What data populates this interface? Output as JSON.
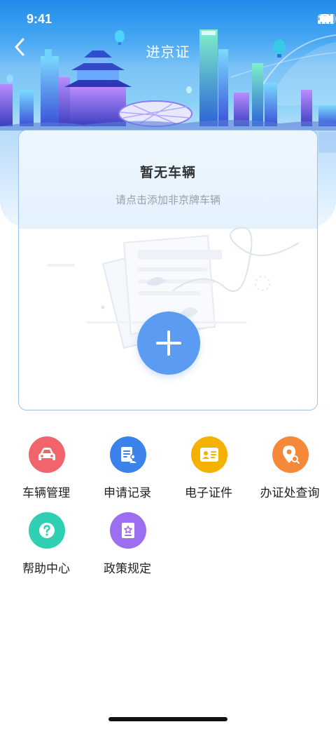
{
  "status_bar": {
    "time": "9:41",
    "icons": [
      "cellular-signal-icon",
      "wifi-icon",
      "battery-icon"
    ]
  },
  "navbar": {
    "title": "进京证",
    "back_icon": "chevron-left-icon"
  },
  "vehicle_card": {
    "empty_title": "暂无车辆",
    "empty_subtitle": "请点击添加非京牌车辆",
    "add_icon": "plus-icon"
  },
  "functions": [
    {
      "label": "车辆管理",
      "icon": "car-icon",
      "color": "#f1646c"
    },
    {
      "label": "申请记录",
      "icon": "form-icon",
      "color": "#3b82ea"
    },
    {
      "label": "电子证件",
      "icon": "id-card-icon",
      "color": "#f5b100"
    },
    {
      "label": "办证处查询",
      "icon": "location-search-icon",
      "color": "#f5893a"
    },
    {
      "label": "帮助中心",
      "icon": "question-icon",
      "color": "#2fcfb4"
    },
    {
      "label": "政策规定",
      "icon": "policy-book-icon",
      "color": "#9b6ff0"
    }
  ],
  "colors": {
    "accent_blue": "#5b9bf2",
    "card_border": "#9dc2ef",
    "subtitle_gray": "#9a9fa8"
  }
}
